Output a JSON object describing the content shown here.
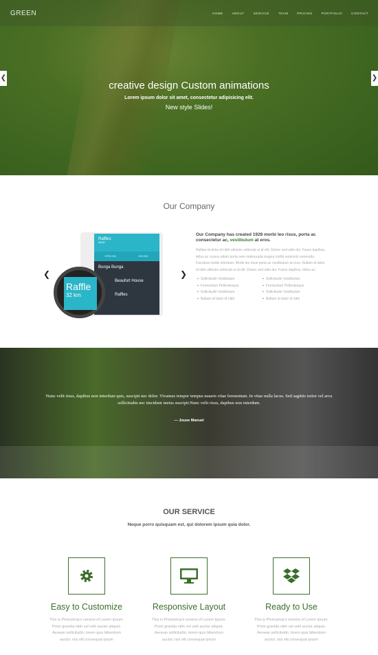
{
  "nav": {
    "logo": "GREEN",
    "items": [
      "HOME",
      "ABOUT",
      "SERVICE",
      "TEAM",
      "PRICING",
      "PORTFOLIO",
      "CONTACT"
    ]
  },
  "hero": {
    "title": "creative design Custom animations",
    "subtitle": "Lorem ipsum dolor sit amet, consectetur adipisicing elit.",
    "subtitle2": "New style Slides!",
    "prev_icon": "chevron-left",
    "next_icon": "chevron-right"
  },
  "company": {
    "title": "Our Company",
    "heading_pre": "Our Company has created 1928 morbi leo risus, porta ac consectetur ac, ",
    "heading_highlight": "vestibulum",
    "heading_post": " at eros.",
    "body": "Nullam id dolor id nibh ultricies vehicula ut id elit. Donec sed odio dui. Fusce dapibus, tellus ac cursus etiam porta sem malesuada magna mollis euismod commodo. Faccibus mollis interdum. Morbi leo risus porta ac vestibulum at eros. Nullam id dolor id nibh ultricies vehicula ut id elit. Donec sed odio dui. Fusce dapibus, tellus ac.",
    "list": [
      "Sollicitudin Vestibulum",
      "Sollicitudin Vestibulum",
      "Fermentum Pellentesque",
      "Fermentum Pellentesque",
      "Sollicitudin Vestibulum",
      "Sollicitudin Vestibulum",
      "Nullam id dolor id nibh",
      "Nullam id dolor id nibh"
    ],
    "app": {
      "header": "Raffles",
      "header_sub": "NEAR",
      "tab1": "OPEN BID",
      "tab2": "JOIN BID",
      "items": [
        "Bunga Bunga",
        "Beaufort House",
        "Raffles"
      ],
      "watch_title": "Raffle",
      "watch_dist": "32 km"
    }
  },
  "quote": {
    "text": "Nunc velit risus, dapibus non interdum quis, suscipit nec dolor. Vivamus tempor tempus mauris vitae fermentum. In vitae nulla lacus. Sed sagittis tortor vel arcu sollicitudin nec tincidunt metus suscipit.Nunc velit risus, dapibus non interdum.",
    "author": "— Jouse Manuel"
  },
  "service": {
    "title": "OUR SERVICE",
    "subtitle": "Neque porro quisquam est, qui dolorem ipsum quia dolor.",
    "items": [
      {
        "title": "Easy to Customize",
        "icon": "gear-icon",
        "text": "This is Photoshop's version of Lorem Ipsum. Proin gravida nibh vel velit auctor aliquet. Aenean sollicitudin, lorem quis bibendum auctor, nisi elit consequat ipsum"
      },
      {
        "title": "Responsive Layout",
        "icon": "monitor-icon",
        "text": "This is Photoshop's version of Lorem Ipsum. Proin gravida nibh vel velit auctor aliquet. Aenean sollicitudin, lorem quis bibendum auctor, nisi elit consequat ipsum"
      },
      {
        "title": "Ready to Use",
        "icon": "dropbox-icon",
        "text": "This is Photoshop's version of Lorem Ipsum. Proin gravida nibh vel velit auctor aliquet. Aenean sollicitudin, lorem quis bibendum auctor, nisi elit consequat ipsum"
      }
    ]
  },
  "colors": {
    "accent": "#3a6e2a",
    "app": "#2bb5c8"
  }
}
